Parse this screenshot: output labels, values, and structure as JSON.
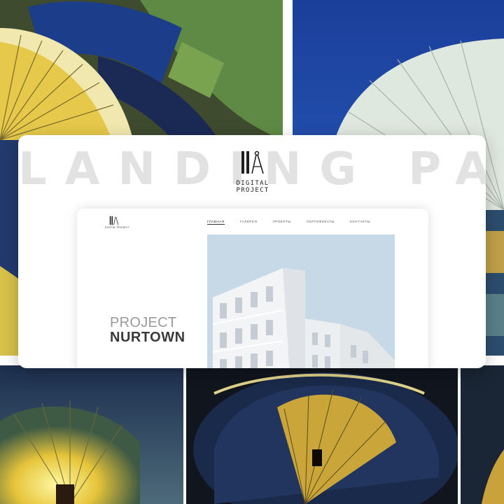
{
  "banner": {
    "title": "LANDING PAGE"
  },
  "brand": {
    "name": "DIGITAL PROJECT",
    "small_name": "DIGITAL PROJECT"
  },
  "nav": {
    "items": [
      {
        "label": "ГЛАВНАЯ",
        "active": true
      },
      {
        "label": "ГАЛЕРЕЯ",
        "active": false
      },
      {
        "label": "ПРОЕКТЫ",
        "active": false
      },
      {
        "label": "СЕРТИФИКАТЫ",
        "active": false
      },
      {
        "label": "КОНТАКТЫ",
        "active": false
      }
    ]
  },
  "hero": {
    "title_light": "PROJECT",
    "title_bold": "NURTOWN"
  },
  "colors": {
    "sky": "#1a45a0",
    "dome_gold": "#e8c84a",
    "card_bg": "#ffffff"
  }
}
